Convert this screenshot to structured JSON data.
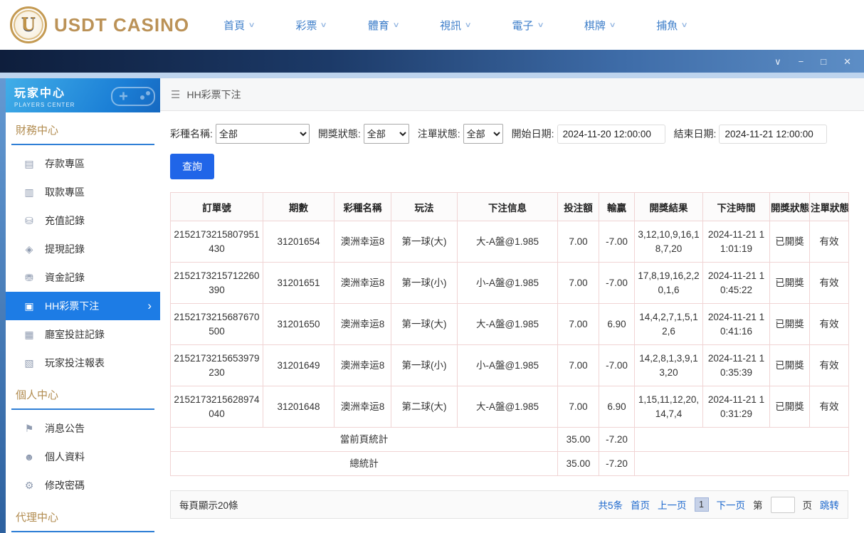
{
  "header": {
    "logo_text": "USDT CASINO",
    "logo_monogram": "U",
    "nav_items": [
      {
        "label": "首頁"
      },
      {
        "label": "彩票"
      },
      {
        "label": "體育"
      },
      {
        "label": "視訊"
      },
      {
        "label": "電子"
      },
      {
        "label": "棋牌"
      },
      {
        "label": "捕魚"
      }
    ]
  },
  "icons": {
    "chevron_down": "∨",
    "chevron_right": "›",
    "menu": "☰",
    "window_collapse": "∨",
    "window_minimize": "−",
    "window_maximize": "□",
    "window_close": "✕"
  },
  "sidebar": {
    "title": "玩家中心",
    "subtitle": "PLAYERS CENTER",
    "sections": [
      {
        "title": "財務中心",
        "items": [
          {
            "label": "存款專區",
            "icon": "▤"
          },
          {
            "label": "取款專區",
            "icon": "▥"
          },
          {
            "label": "充值記錄",
            "icon": "⛁"
          },
          {
            "label": "提現記錄",
            "icon": "◈"
          },
          {
            "label": "資金記錄",
            "icon": "⛃"
          },
          {
            "label": "HH彩票下注",
            "icon": "▣"
          },
          {
            "label": "廳室投註記錄",
            "icon": "▦"
          },
          {
            "label": "玩家投注報表",
            "icon": "▧"
          }
        ]
      },
      {
        "title": "個人中心",
        "items": [
          {
            "label": "消息公告",
            "icon": "⚑"
          },
          {
            "label": "個人資料",
            "icon": "☻"
          },
          {
            "label": "修改密碼",
            "icon": "⚙"
          }
        ]
      },
      {
        "title": "代理中心",
        "items": []
      }
    ]
  },
  "breadcrumb": {
    "title": "HH彩票下注"
  },
  "filters": {
    "lottery_label": "彩種名稱:",
    "lottery_value": "全部",
    "draw_status_label": "開獎狀態:",
    "draw_status_value": "全部",
    "order_status_label": "注單狀態:",
    "order_status_value": "全部",
    "start_label": "開始日期:",
    "start_value": "2024-11-20 12:00:00",
    "end_label": "結束日期:",
    "end_value": "2024-11-21 12:00:00",
    "query_button": "查詢"
  },
  "table": {
    "headers": [
      "訂單號",
      "期數",
      "彩種名稱",
      "玩法",
      "下注信息",
      "投注額",
      "輸贏",
      "開獎結果",
      "下注時間",
      "開獎狀態",
      "注單狀態"
    ],
    "rows": [
      {
        "order_no": "2152173215807951430",
        "issue": "31201654",
        "lottery": "澳洲幸运8",
        "play": "第一球(大)",
        "bet_info": "大-A盤@1.985",
        "amount": "7.00",
        "win_loss": "-7.00",
        "result": "3,12,10,9,16,18,7,20",
        "bet_time": "2024-11-21 11:01:19",
        "draw_status": "已開獎",
        "order_status": "有效"
      },
      {
        "order_no": "2152173215712260390",
        "issue": "31201651",
        "lottery": "澳洲幸运8",
        "play": "第一球(小)",
        "bet_info": "小-A盤@1.985",
        "amount": "7.00",
        "win_loss": "-7.00",
        "result": "17,8,19,16,2,20,1,6",
        "bet_time": "2024-11-21 10:45:22",
        "draw_status": "已開獎",
        "order_status": "有效"
      },
      {
        "order_no": "2152173215687670500",
        "issue": "31201650",
        "lottery": "澳洲幸运8",
        "play": "第一球(大)",
        "bet_info": "大-A盤@1.985",
        "amount": "7.00",
        "win_loss": "6.90",
        "result": "14,4,2,7,1,5,12,6",
        "bet_time": "2024-11-21 10:41:16",
        "draw_status": "已開獎",
        "order_status": "有效"
      },
      {
        "order_no": "2152173215653979230",
        "issue": "31201649",
        "lottery": "澳洲幸运8",
        "play": "第一球(小)",
        "bet_info": "小-A盤@1.985",
        "amount": "7.00",
        "win_loss": "-7.00",
        "result": "14,2,8,1,3,9,13,20",
        "bet_time": "2024-11-21 10:35:39",
        "draw_status": "已開獎",
        "order_status": "有效"
      },
      {
        "order_no": "2152173215628974040",
        "issue": "31201648",
        "lottery": "澳洲幸运8",
        "play": "第二球(大)",
        "bet_info": "大-A盤@1.985",
        "amount": "7.00",
        "win_loss": "6.90",
        "result": "1,15,11,12,20,14,7,4",
        "bet_time": "2024-11-21 10:31:29",
        "draw_status": "已開獎",
        "order_status": "有效"
      }
    ],
    "page_summary": {
      "label": "當前頁統計",
      "amount": "35.00",
      "win_loss": "-7.20"
    },
    "total_summary": {
      "label": "總統計",
      "amount": "35.00",
      "win_loss": "-7.20"
    }
  },
  "pagination": {
    "page_size_text": "每頁顯示20條",
    "total_text": "共5条",
    "first": "首页",
    "prev": "上一页",
    "current_page": "1",
    "next": "下一页",
    "goto_prefix": "第",
    "goto_suffix": "页",
    "goto_button": "跳转"
  }
}
